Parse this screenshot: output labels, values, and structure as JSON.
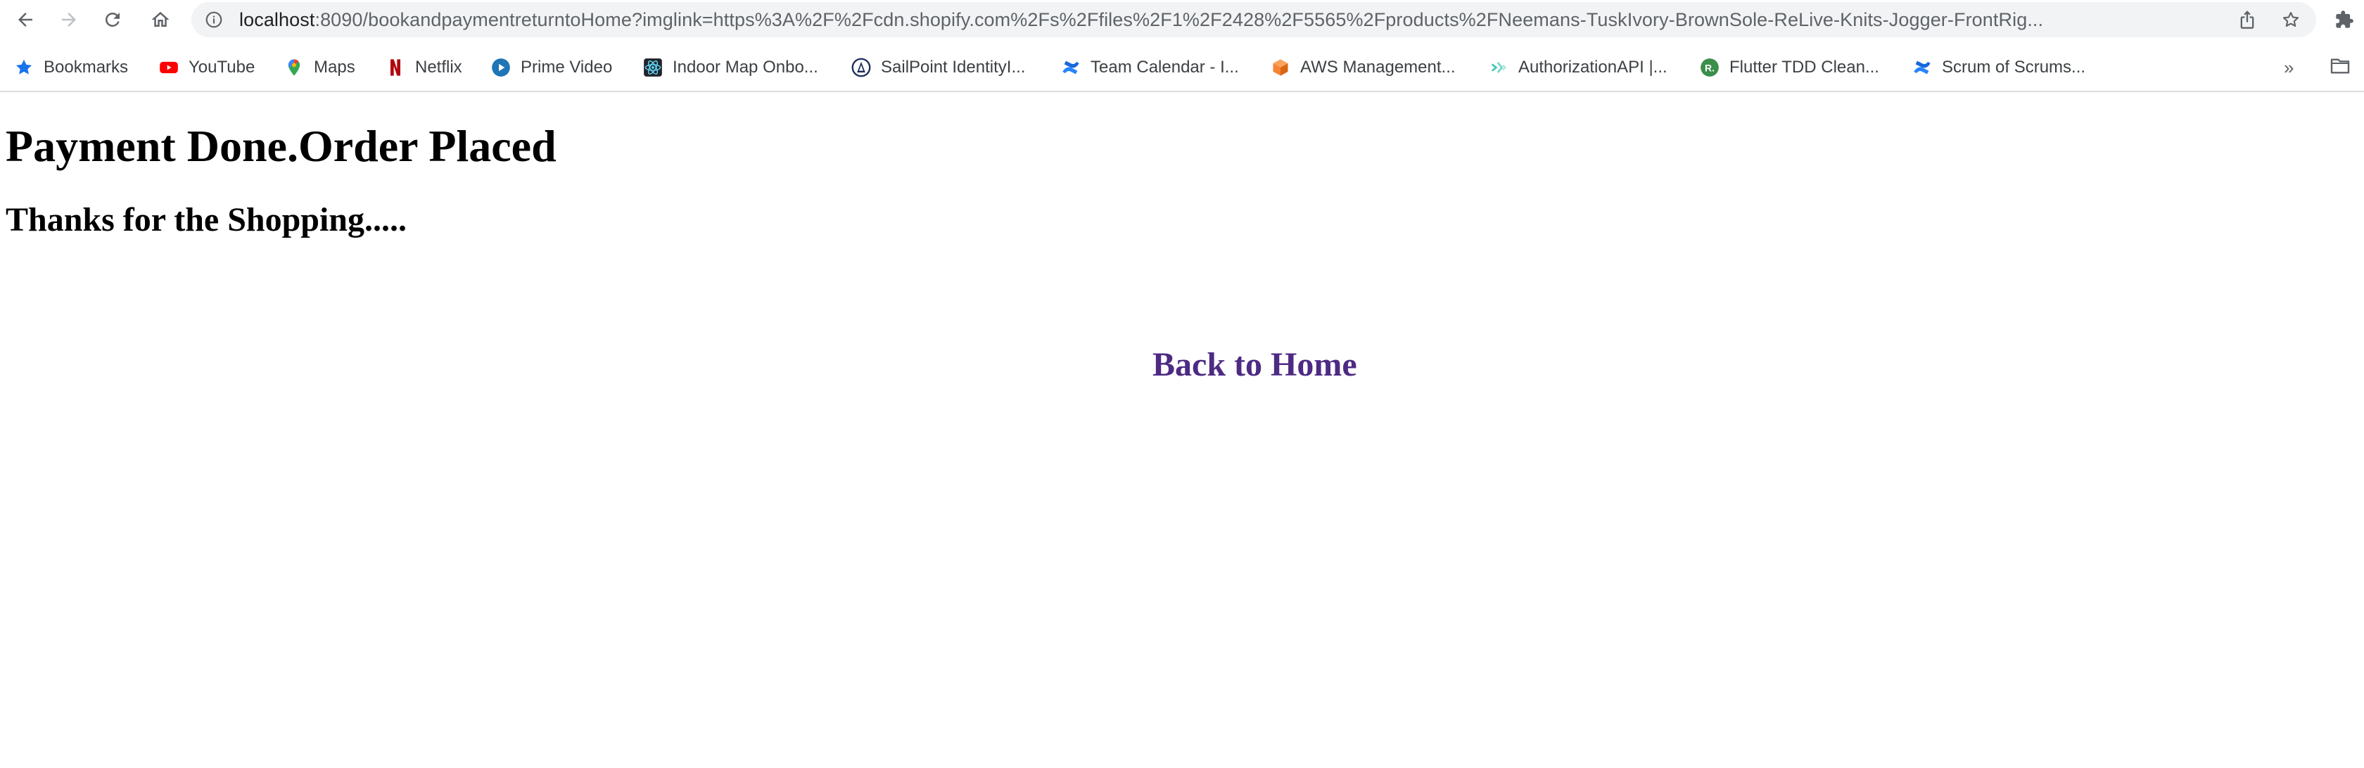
{
  "browser": {
    "url_host": "localhost",
    "url_rest": ":8090/bookandpaymentreturntoHome?imglink=https%3A%2F%2Fcdn.shopify.com%2Fs%2Ffiles%2F1%2F2428%2F5565%2Fproducts%2FNeemans-TuskIvory-BrownSole-ReLive-Knits-Jogger-FrontRig...",
    "accent_color": "#1a73e8"
  },
  "bookmarks": {
    "items": [
      {
        "label": "Bookmarks",
        "icon": "star-icon"
      },
      {
        "label": "YouTube",
        "icon": "youtube-icon"
      },
      {
        "label": "Maps",
        "icon": "maps-pin-icon"
      },
      {
        "label": "Netflix",
        "icon": "netflix-icon"
      },
      {
        "label": "Prime Video",
        "icon": "prime-video-icon"
      },
      {
        "label": "Indoor Map Onbo...",
        "icon": "react-icon"
      },
      {
        "label": "SailPoint IdentityI...",
        "icon": "sailpoint-icon"
      },
      {
        "label": "Team Calendar - I...",
        "icon": "confluence-icon"
      },
      {
        "label": "AWS Management...",
        "icon": "aws-cube-icon"
      },
      {
        "label": "AuthorizationAPI |...",
        "icon": "api-icon"
      },
      {
        "label": "Flutter TDD Clean...",
        "icon": "r-circle-icon"
      },
      {
        "label": "Scrum of Scrums...",
        "icon": "confluence-icon"
      }
    ],
    "more_label": "»"
  },
  "page": {
    "heading": "Payment Done.Order Placed",
    "subheading": "Thanks for the Shopping.....",
    "home_link": "Back to Home",
    "link_color": "#4d2a83"
  }
}
